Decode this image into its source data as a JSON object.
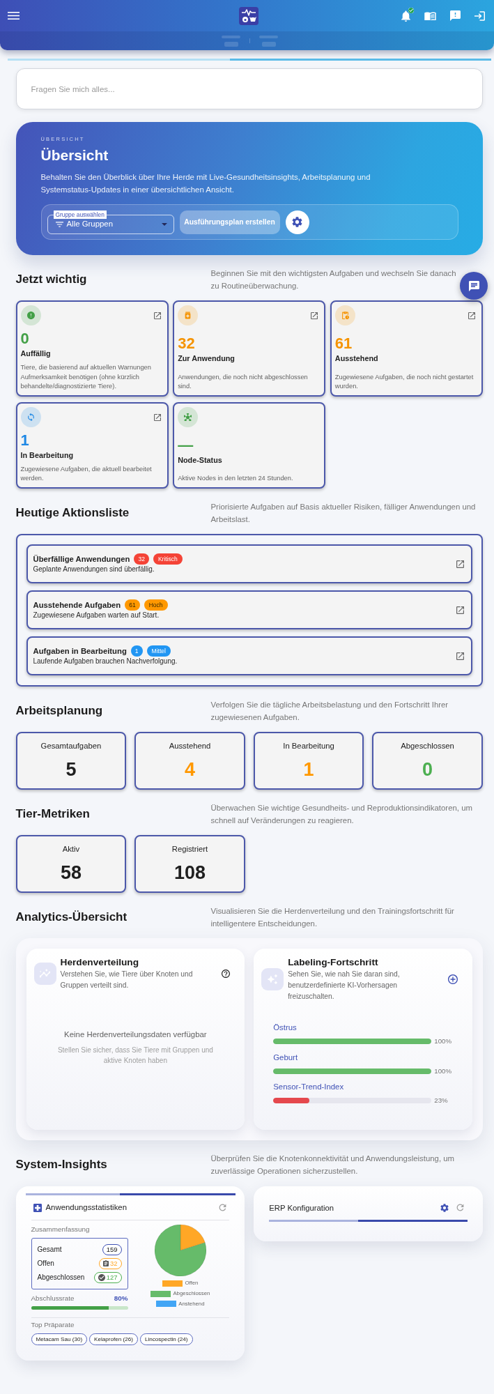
{
  "search_field": {
    "placeholder": "Fragen Sie mich alles..."
  },
  "overview": {
    "eyebrow": "ÜBERSICHT",
    "title": "Übersicht",
    "description": "Behalten Sie den Überblick über Ihre Herde mit Live-Gesundheitsinsights, Arbeitsplanung und Systemstatus-Updates in einer übersichtlichen Ansicht.",
    "group_select": {
      "label": "Gruppe auswählen",
      "value": "Alle Gruppen"
    },
    "plan_button": "Ausführungsplan erstellen"
  },
  "priority_section": {
    "title": "Jetzt wichtig",
    "description": "Beginnen Sie mit den wichtigsten Aufgaben und wechseln Sie danach zu Routineüberwachung.",
    "cards": [
      {
        "value": "0",
        "label": "Auffällig",
        "description": "Tiere, die basierend auf aktuellen Warnungen Aufmerksamkeit benötigen (ohne kürzlich behandelte/diagnostizierte Tiere).",
        "color": "#43a047",
        "linked": true
      },
      {
        "value": "32",
        "label": "Zur Anwendung",
        "description": "Anwendungen, die noch nicht abgeschlossen sind.",
        "color": "#f59300",
        "linked": true
      },
      {
        "value": "61",
        "label": "Ausstehend",
        "description": "Zugewiesene Aufgaben, die noch nicht gestartet wurden.",
        "color": "#f59300",
        "linked": true
      },
      {
        "value": "1",
        "label": "In Bearbeitung",
        "description": "Zugewiesene Aufgaben, die aktuell bearbeitet werden.",
        "color": "#1e88e5",
        "linked": true
      },
      {
        "value": "—",
        "label": "Node-Status",
        "description": "Aktive Nodes in den letzten 24 Stunden.",
        "color": "#43a047",
        "linked": false
      }
    ]
  },
  "action_section": {
    "title": "Heutige Aktionsliste",
    "description": "Priorisierte Aufgaben auf Basis aktueller Risiken, fälliger Anwendungen und Arbeitslast.",
    "items": [
      {
        "title": "Überfällige Anwendungen",
        "count": "32",
        "priority": "Kritisch",
        "description": "Geplante Anwendungen sind überfällig.",
        "color": "#f44336"
      },
      {
        "title": "Ausstehende Aufgaben",
        "count": "61",
        "priority": "Hoch",
        "description": "Zugewiesene Aufgaben warten auf Start.",
        "color": "#ff9800"
      },
      {
        "title": "Aufgaben in Bearbeitung",
        "count": "1",
        "priority": "Mittel",
        "description": "Laufende Aufgaben brauchen Nachverfolgung.",
        "color": "#2196f3"
      }
    ]
  },
  "workload_section": {
    "title": "Arbeitsplanung",
    "description": "Verfolgen Sie die tägliche Arbeitsbelastung und den Fortschritt Ihrer zugewiesenen Aufgaben.",
    "stats": [
      {
        "label": "Gesamtaufgaben",
        "value": "5",
        "color": "#1f1f1f"
      },
      {
        "label": "Ausstehend",
        "value": "4",
        "color": "#ff9800"
      },
      {
        "label": "In Bearbeitung",
        "value": "1",
        "color": "#ff9800"
      },
      {
        "label": "Abgeschlossen",
        "value": "0",
        "color": "#4caf50"
      }
    ]
  },
  "animal_section": {
    "title": "Tier-Metriken",
    "description": "Überwachen Sie wichtige Gesundheits- und Reproduktionsindikatoren, um schnell auf Veränderungen zu reagieren.",
    "stats": [
      {
        "label": "Aktiv",
        "value": "58"
      },
      {
        "label": "Registriert",
        "value": "108"
      }
    ]
  },
  "analytics_section": {
    "title": "Analytics-Übersicht",
    "description": "Visualisieren Sie die Herdenverteilung und den Trainingsfortschritt für intelligentere Entscheidungen.",
    "herd_distribution": {
      "title": "Herdenverteilung",
      "description": "Verstehen Sie, wie Tiere über Knoten und Gruppen verteilt sind.",
      "empty_title": "Keine Herdenverteilungsdaten verfügbar",
      "empty_hint": "Stellen Sie sicher, dass Sie Tiere mit Gruppen und aktive Knoten haben"
    },
    "labeling_progress": {
      "title": "Labeling-Fortschritt",
      "description": "Sehen Sie, wie nah Sie daran sind, benutzerdefinierte KI-Vorhersagen freizuschalten.",
      "items": [
        {
          "label": "Östrus",
          "level": 1,
          "reading": "100%",
          "color": "#66bb6a"
        },
        {
          "label": "Geburt",
          "level": 1,
          "reading": "100%",
          "color": "#66bb6a"
        },
        {
          "label": "Sensor-Trend-Index",
          "level": 0.23,
          "reading": "23%",
          "color": "#e5484d"
        }
      ]
    }
  },
  "insights_section": {
    "title": "System-Insights",
    "description": "Überprüfen Sie die Knotenkonnektivität und Anwendungsleistung, um zuverlässige Operationen sicherzustellen.",
    "app_stats": {
      "title": "Anwendungsstatistiken",
      "summary_label": "Zusammenfassung",
      "summary": [
        {
          "kind": "total",
          "label": "Gesamt",
          "value": "159",
          "color": "#3f51b5"
        },
        {
          "kind": "open",
          "label": "Offen",
          "value": "32",
          "color": "#ffa726"
        },
        {
          "kind": "done",
          "label": "Abgeschlossen",
          "value": "127",
          "color": "#4caf50"
        }
      ],
      "completion_rate": {
        "label": "Abschlussrate",
        "reading": "80%",
        "level": 0.8
      },
      "top_label": "Top Präparate",
      "top_products": [
        "Metacam Sau (30)",
        "Kelaprofen (26)",
        "Lincospectin (24)"
      ],
      "chart_data": {
        "type": "pie",
        "categories": [
          "Offen",
          "Abgeschlossen",
          "Anstehend"
        ],
        "values": [
          20.1,
          79.9,
          0
        ],
        "colors": [
          "#ffa726",
          "#66bb6a",
          "#42a5f5"
        ],
        "legend": "bottom"
      }
    },
    "erp": {
      "title": "ERP Konfiguration"
    }
  }
}
